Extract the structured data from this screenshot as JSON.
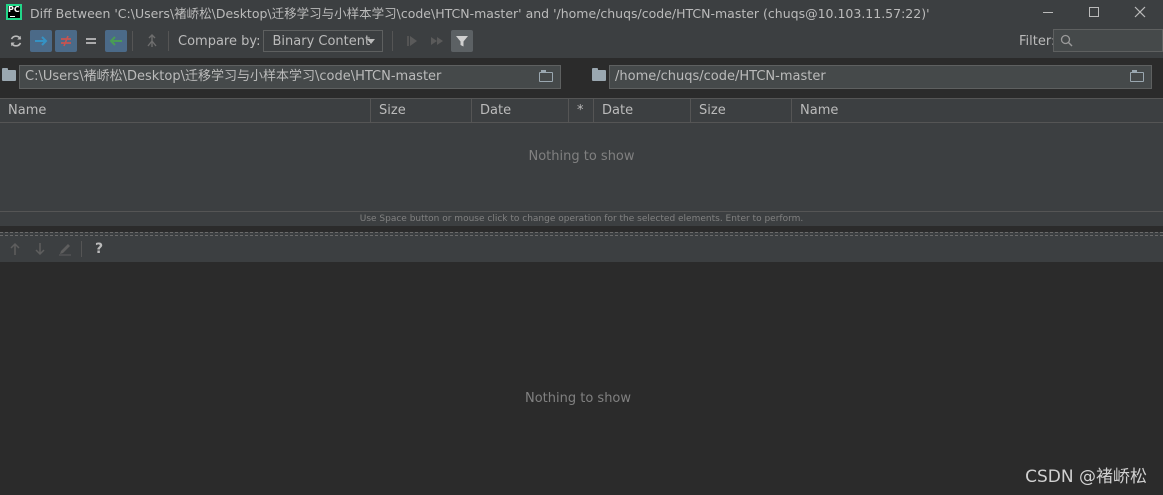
{
  "window": {
    "title": "Diff Between 'C:\\Users\\褚峤松\\Desktop\\迁移学习与小样本学习\\code\\HTCN-master' and '/home/chuqs/code/HTCN-master (chuqs@10.103.11.57:22)'",
    "app_logo_text": "PC"
  },
  "toolbar": {
    "compare_label": "Compare by:",
    "compare_value": "Binary Content",
    "filter_label": "Filter:"
  },
  "paths": {
    "left": "C:\\Users\\褚峤松\\Desktop\\迁移学习与小样本学习\\code\\HTCN-master",
    "right": "/home/chuqs/code/HTCN-master"
  },
  "table": {
    "columns": [
      "Name",
      "Size",
      "Date",
      "*",
      "Date",
      "Size",
      "Name"
    ],
    "empty_text": "Nothing to show"
  },
  "hint": "Use Space button or mouse click to change operation for the selected elements. Enter to perform.",
  "bottom": {
    "help": "?",
    "empty_text": "Nothing to show"
  },
  "watermark": "CSDN @褚峤松",
  "colors": {
    "background": "#2b2b2b",
    "panel": "#3c3f41",
    "selected": "#4b6a88",
    "accent_blue": "#3592c4",
    "accent_red": "#c75450",
    "accent_green": "#499c54"
  }
}
